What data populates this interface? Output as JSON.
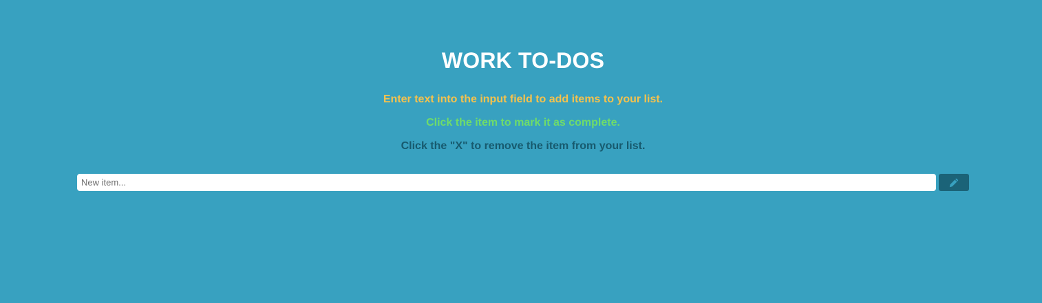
{
  "header": {
    "title": "WORK TO-DOS"
  },
  "instructions": {
    "add": "Enter text into the input field to add items to your list.",
    "complete": "Click the item to mark it as complete.",
    "remove": "Click the \"X\" to remove the item from your list."
  },
  "form": {
    "input_placeholder": "New item...",
    "input_value": "",
    "add_button_icon": "pencil-icon"
  },
  "colors": {
    "background": "#38a1c0",
    "title": "#ffffff",
    "add_instruction": "#f5c24d",
    "complete_instruction": "#6fdc6a",
    "remove_instruction": "#175a6e",
    "button": "#1b6378",
    "button_icon": "#38a1c0"
  }
}
